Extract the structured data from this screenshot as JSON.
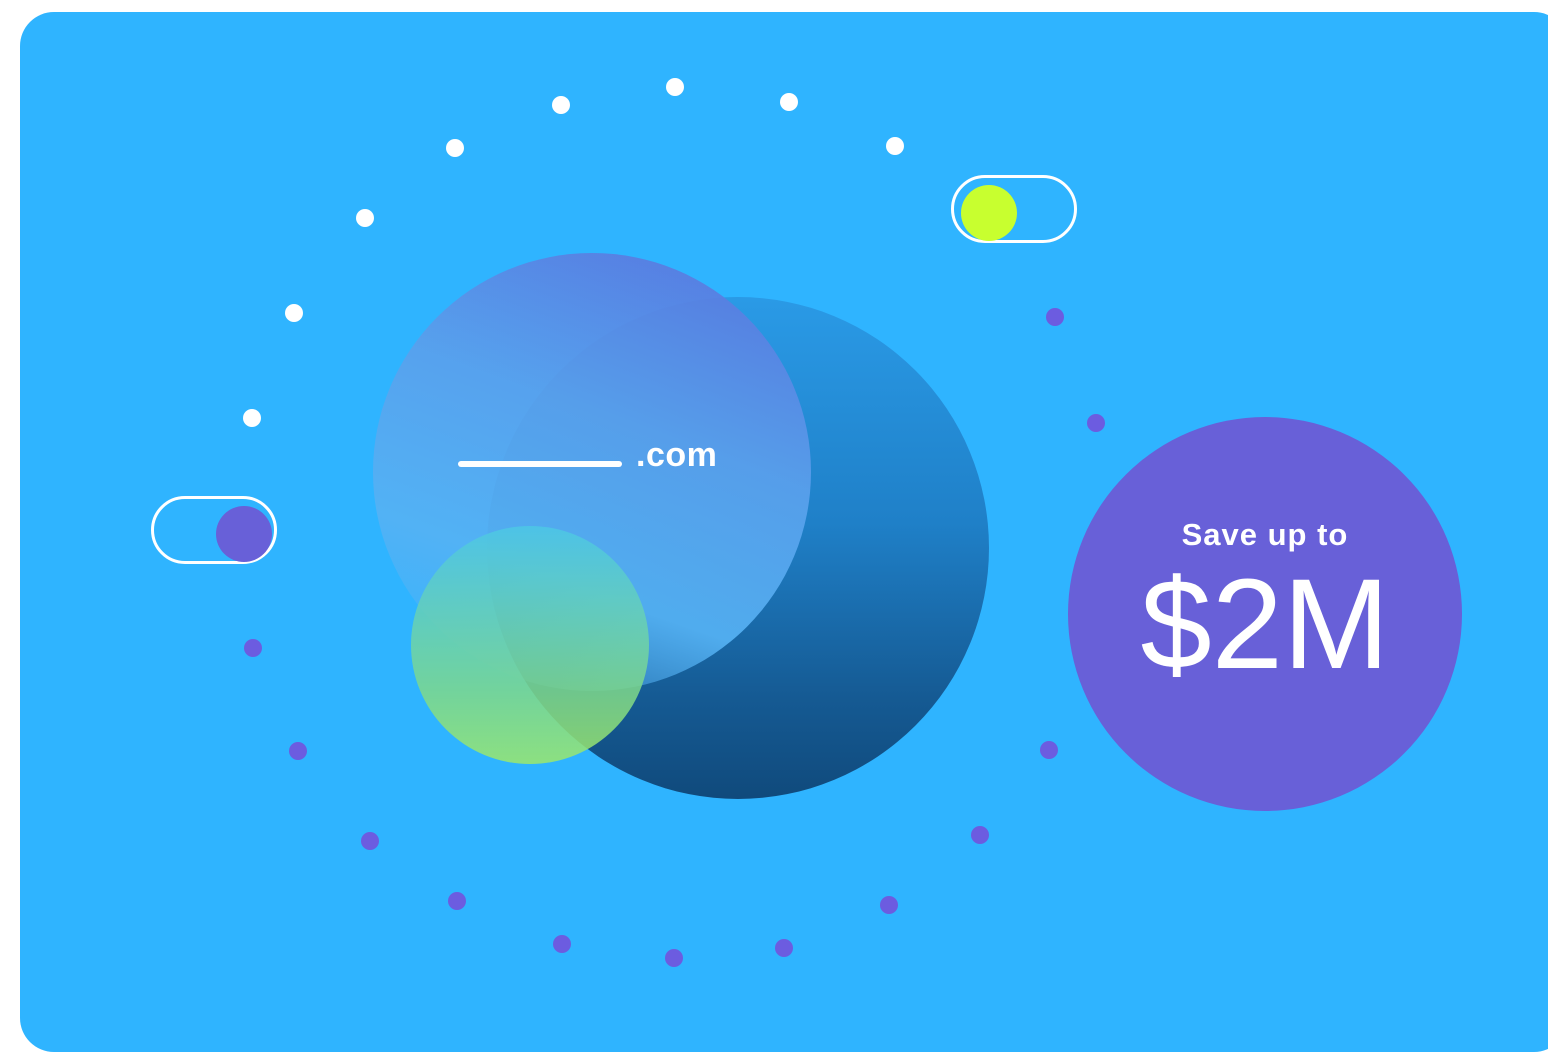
{
  "domain_label": ".com",
  "badge": {
    "caption": "Save up to",
    "amount": "$2M"
  },
  "colors": {
    "background": "#2fb4ff",
    "badge": "#6860d8",
    "dot_white": "#ffffff",
    "dot_purple": "#6c5ce0",
    "toggle_on_knob": "#c8ff2f",
    "toggle_off_knob": "#6860d8"
  },
  "toggles": [
    {
      "name": "toggle-top-right",
      "state": "on",
      "knob_color": "#c8ff2f"
    },
    {
      "name": "toggle-left",
      "state": "on",
      "knob_color": "#6860d8"
    }
  ]
}
